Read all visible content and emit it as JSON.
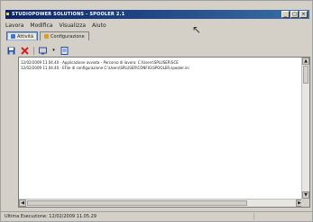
{
  "window": {
    "title": "STUDIOPOWER SOLUTIONS - SPOOLER 2.1",
    "controls": [
      "_",
      "□",
      "×"
    ]
  },
  "menu": {
    "items": [
      "Lavora",
      "Modifica",
      "Visualizza",
      "Aiuto"
    ]
  },
  "tabs": [
    {
      "label": "Attività",
      "icon_color": "#3a78d8",
      "active": true
    },
    {
      "label": "Configurazione",
      "icon_color": "#d8a020",
      "active": false
    }
  ],
  "toolbar": {
    "buttons": [
      {
        "icon": "save-icon",
        "color": "#1f4fa8"
      },
      {
        "icon": "delete-icon",
        "color": "#d42020"
      },
      {
        "icon": "screen-icon",
        "color": "#1f4fa8"
      },
      {
        "icon": "properties-icon",
        "color": "#1f4fa8"
      }
    ]
  },
  "log": {
    "lines": [
      "12/02/2009 11.04.40 - Applicazione avviata - Percorso di lavoro: C:\\Users\\SPLUSER\\SCE",
      "12/02/2009 11.04.40 - EFile di configurazione C:\\Users\\SPLUSER\\CONFIG\\SPOOLER.spooler.ini"
    ]
  },
  "status": {
    "text": "Ultima Esecuzione: 12/02/2009 11.05.29"
  },
  "colors": {
    "titlebar_start": "#0a246a",
    "titlebar_end": "#3a6ea5",
    "window_bg": "#d4d0c8"
  }
}
